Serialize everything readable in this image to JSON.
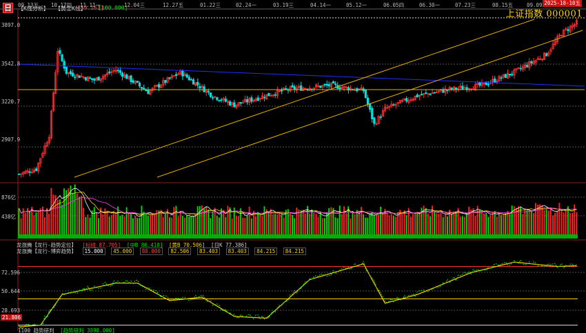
{
  "toolbar": {
    "logo_glyph": "日",
    "k_analysis": "【K线分析】",
    "gold_k": "【黄金K线】",
    "value_red": "[59.161]",
    "value_green": "[100.000]"
  },
  "date_axis": [
    "09.13五",
    "10.17四",
    "11.11一",
    "12.04三",
    "12.27五",
    "01.22三",
    "02.24一",
    "03.19三",
    "04.14一",
    "05.12一",
    "06.05四",
    "06.30一",
    "07.23三",
    "08.15五",
    "09.09二"
  ],
  "title": "上证指数  000001",
  "date_badge": "2025-10-10五",
  "price_axis": [
    "3897.0",
    "3542.8",
    "3220.7",
    "2907.9"
  ],
  "volume_axis": [
    "876亿",
    "438亿"
  ],
  "indicator_axis": [
    "72.596",
    "50.644",
    "28.693",
    "21.806"
  ],
  "ind_header_1": {
    "name": "龙涨腾【龙行-趋势定位】",
    "v1": "[标线 87.705]",
    "v2": "[中B 86.410]",
    "v3": "[黄B 70.506]",
    "v4": "[日K 77.386]"
  },
  "ind_header_2": {
    "name": "龙涨腾【龙行-博弈趋势】",
    "vals": [
      "15.000",
      "45.000",
      "80.000",
      "82.506",
      "83.403",
      "83.403",
      "84.215",
      "84.215"
    ]
  },
  "footer_label": "1100 趋势研判",
  "footer_value": "[趋势研判 3898.000]",
  "colors": {
    "up": "#ff3030",
    "down": "#00e0e0",
    "vol_up": "#ff2020",
    "vol_down": "#00dd00",
    "trend": "#e8b000",
    "blue_line": "#2030ff"
  },
  "chart_data": {
    "type": "candlestick",
    "price_axis_ticks": [
      3897.0,
      3542.8,
      3220.7,
      2907.9
    ],
    "start": 2700,
    "ylim": [
      2650,
      3960
    ],
    "volume_ylim": [
      0,
      1200
    ],
    "indicator_ylim": [
      15,
      100
    ],
    "title": "上证指数  000001"
  }
}
